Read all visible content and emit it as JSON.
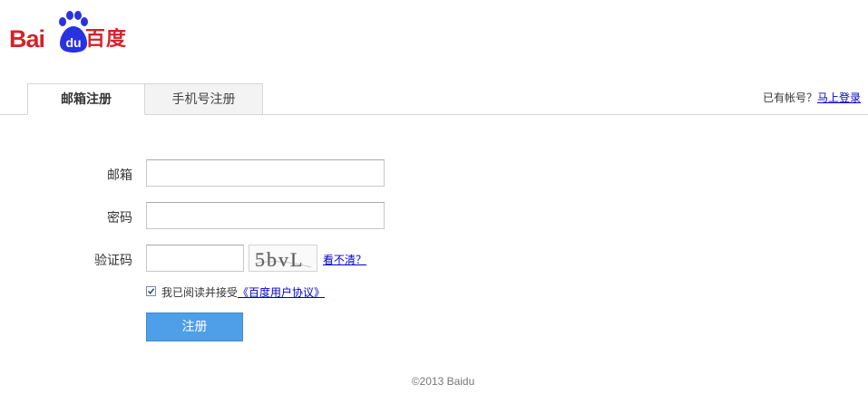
{
  "logo": {
    "text_left": "Bai",
    "paw_text": "du",
    "text_cn": "百度"
  },
  "tabs": [
    {
      "label": "邮箱注册",
      "active": true
    },
    {
      "label": "手机号注册",
      "active": false
    }
  ],
  "login_hint": {
    "prefix": "已有帐号？",
    "link": "马上登录"
  },
  "form": {
    "email_label": "邮箱",
    "email_value": "",
    "password_label": "密码",
    "password_value": "",
    "captcha_label": "验证码",
    "captcha_value": "",
    "captcha_image_text": "5bvL",
    "captcha_refresh": "看不清？",
    "agree_prefix": "我已阅读并接受",
    "agree_link": "《百度用户协议》",
    "agree_checked": true,
    "submit": "注册"
  },
  "footer": "©2013 Baidu",
  "colors": {
    "brand_red": "#d8212a",
    "brand_blue": "#2932e1",
    "link": "#0000cc",
    "button": "#4f9ee8"
  }
}
